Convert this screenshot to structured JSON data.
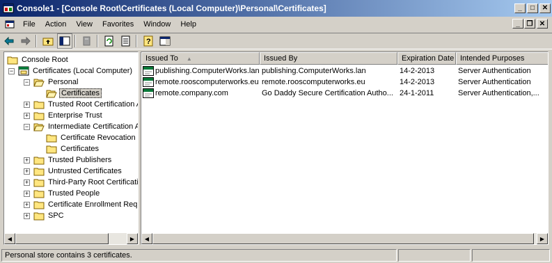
{
  "window": {
    "title": "Console1 - [Console Root\\Certificates (Local Computer)\\Personal\\Certificates]"
  },
  "menu": {
    "items": [
      {
        "label": "File",
        "key": "F",
        "rest": "ile"
      },
      {
        "label": "Action",
        "key": "A",
        "rest": "ction"
      },
      {
        "label": "View",
        "key": "V",
        "rest": "iew"
      },
      {
        "label": "Favorites",
        "key": "",
        "pre": "Fav",
        "key2": "o",
        "rest": "rites"
      },
      {
        "label": "Window",
        "key": "W",
        "rest": "indow"
      },
      {
        "label": "Help",
        "key": "H",
        "rest": "elp"
      }
    ]
  },
  "tree": {
    "items": [
      {
        "label": "Console Root"
      },
      {
        "label": "Certificates (Local Computer)"
      },
      {
        "label": "Personal"
      },
      {
        "label": "Certificates"
      },
      {
        "label": "Trusted Root Certification A"
      },
      {
        "label": "Enterprise Trust"
      },
      {
        "label": "Intermediate Certification A"
      },
      {
        "label": "Certificate Revocation I"
      },
      {
        "label": "Certificates"
      },
      {
        "label": "Trusted Publishers"
      },
      {
        "label": "Untrusted Certificates"
      },
      {
        "label": "Third-Party Root Certificatio"
      },
      {
        "label": "Trusted People"
      },
      {
        "label": "Certificate Enrollment Requ"
      },
      {
        "label": "SPC"
      }
    ]
  },
  "list": {
    "columns": [
      "Issued To",
      "Issued By",
      "Expiration Date",
      "Intended Purposes"
    ],
    "rows": [
      [
        "publishing.ComputerWorks.lan",
        "publishing.ComputerWorks.lan",
        "14-2-2013",
        "Server Authentication"
      ],
      [
        "remote.rooscomputerworks.eu",
        "remote.rooscomputerworks.eu",
        "14-2-2013",
        "Server Authentication"
      ],
      [
        "remote.company.com",
        "Go Daddy Secure Certification Autho...",
        "24-1-2011",
        "Server Authentication,..."
      ]
    ]
  },
  "status": {
    "text": "Personal store contains 3 certificates."
  }
}
